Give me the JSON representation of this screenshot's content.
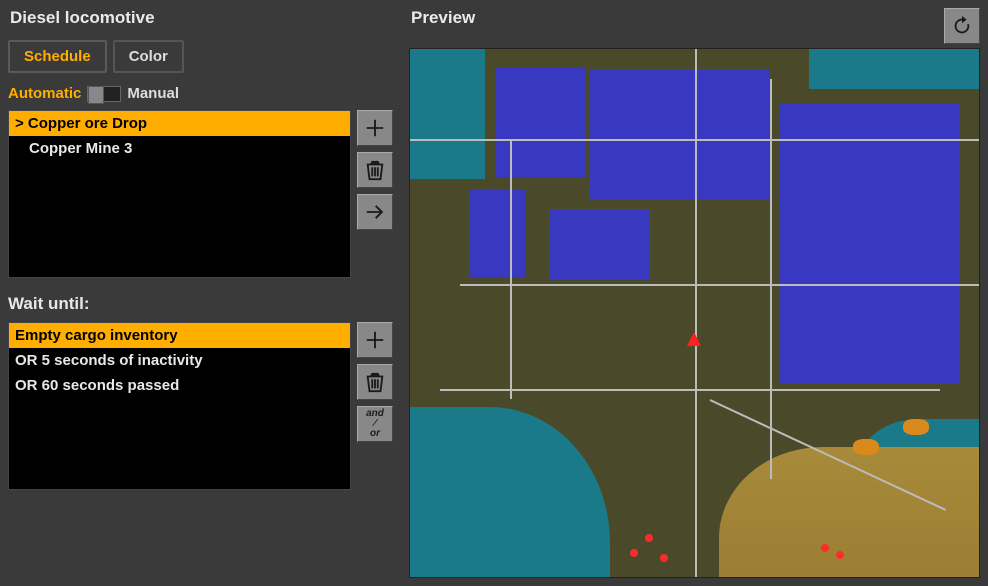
{
  "panel_title": "Diesel locomotive",
  "tabs": {
    "schedule": "Schedule",
    "color": "Color",
    "active": "schedule"
  },
  "mode_toggle": {
    "auto": "Automatic",
    "manual": "Manual",
    "value": "automatic"
  },
  "schedule": {
    "stations": [
      {
        "label": "> Copper ore Drop",
        "selected": true
      },
      {
        "label": "Copper Mine 3",
        "selected": false
      }
    ]
  },
  "wait_heading": "Wait until:",
  "conditions": {
    "items": [
      {
        "label": "Empty cargo inventory",
        "selected": true
      },
      {
        "label": "OR 5 seconds of inactivity",
        "selected": false
      },
      {
        "label": "OR 60 seconds passed",
        "selected": false
      }
    ]
  },
  "buttons": {
    "add": "+",
    "delete": "🗑",
    "go": "→",
    "andor_top": "and",
    "andor_bot": "or"
  },
  "preview": {
    "title": "Preview",
    "refresh": "↻"
  }
}
